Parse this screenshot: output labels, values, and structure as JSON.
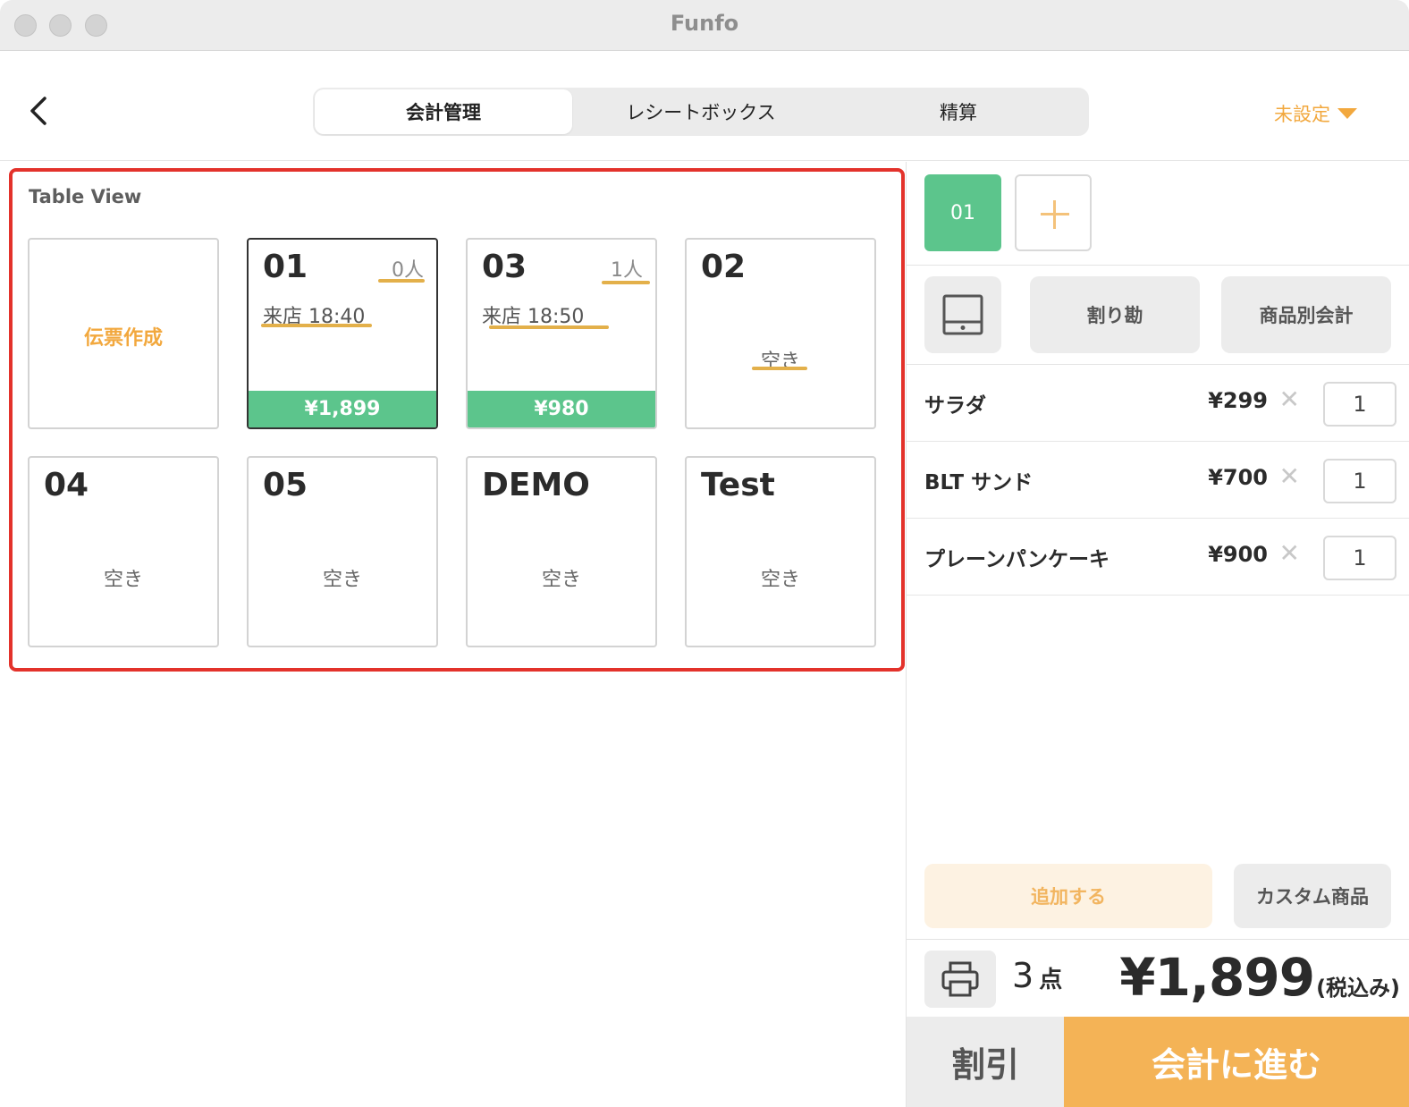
{
  "window": {
    "title": "Funfo"
  },
  "header": {
    "tabs": [
      {
        "label": "会計管理",
        "active": true
      },
      {
        "label": "レシートボックス",
        "active": false
      },
      {
        "label": "精算",
        "active": false
      }
    ],
    "status_label": "未設定"
  },
  "table_view": {
    "title": "Table View",
    "create_label": "伝票作成",
    "tables": [
      {
        "name": "01",
        "people": "0人",
        "arrival": "来店 18:40",
        "price": "¥1,899",
        "selected": true
      },
      {
        "name": "03",
        "people": "1人",
        "arrival": "来店 18:50",
        "price": "¥980",
        "selected": false
      },
      {
        "name": "02",
        "status": "空き"
      },
      {
        "name": "04",
        "status": "空き"
      },
      {
        "name": "05",
        "status": "空き"
      },
      {
        "name": "DEMO",
        "status": "空き"
      },
      {
        "name": "Test",
        "status": "空き"
      }
    ]
  },
  "order": {
    "ticket_tab": "01",
    "actions": {
      "split_label": "割り勘",
      "by_item_label": "商品別会計"
    },
    "items": [
      {
        "name": "サラダ",
        "price": "¥299",
        "qty": "1"
      },
      {
        "name": "BLT サンド",
        "price": "¥700",
        "qty": "1"
      },
      {
        "name": "プレーンパンケーキ",
        "price": "¥900",
        "qty": "1"
      }
    ],
    "add_label": "追加する",
    "custom_label": "カスタム商品",
    "count": "3",
    "count_unit": "点",
    "total": "¥1,899",
    "tax_note": "(税込み)",
    "discount_label": "割引",
    "checkout_label": "会計に進む"
  },
  "colors": {
    "accent": "#f2a83e",
    "green": "#5cc58c",
    "highlight": "#e3322b"
  },
  "icons": [
    "chevron-left-icon",
    "caret-down-icon",
    "plus-icon",
    "tablet-icon",
    "remove-icon",
    "printer-icon"
  ]
}
